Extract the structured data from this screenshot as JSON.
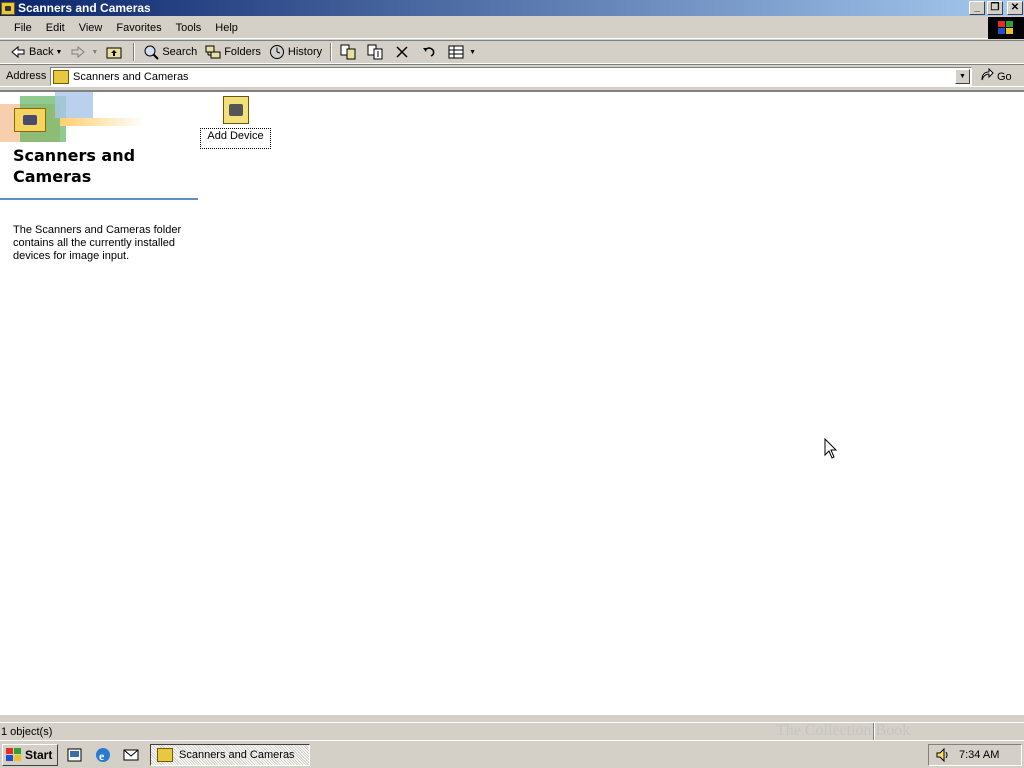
{
  "window": {
    "title": "Scanners and Cameras"
  },
  "menu": {
    "items": [
      "File",
      "Edit",
      "View",
      "Favorites",
      "Tools",
      "Help"
    ]
  },
  "toolbar": {
    "back_label": "Back",
    "search_label": "Search",
    "folders_label": "Folders",
    "history_label": "History"
  },
  "address": {
    "label": "Address",
    "value": "Scanners and Cameras",
    "go_label": "Go"
  },
  "panel": {
    "title": "Scanners and Cameras",
    "description": "The Scanners and Cameras folder contains all the currently installed devices for image input."
  },
  "items": [
    {
      "label": "Add Device"
    }
  ],
  "status": {
    "text": "1 object(s)"
  },
  "taskbar": {
    "start_label": "Start",
    "task_label": "Scanners and Cameras",
    "clock": "7:34 AM"
  },
  "watermark": {
    "text": "The Collection Book"
  }
}
